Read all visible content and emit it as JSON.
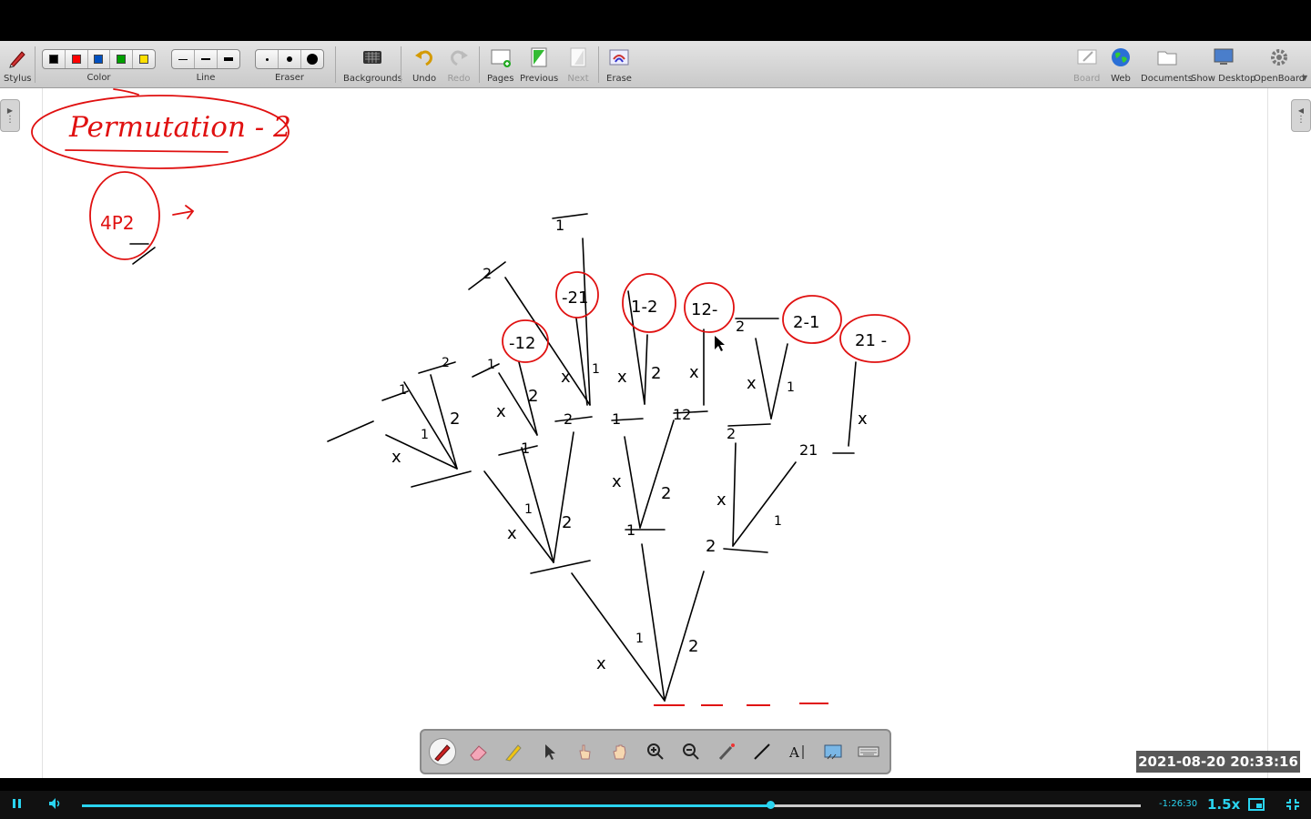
{
  "toolbar": {
    "stylus": "Stylus",
    "color": "Color",
    "line": "Line",
    "eraser": "Eraser",
    "backgrounds": "Backgrounds",
    "undo": "Undo",
    "redo": "Redo",
    "pages": "Pages",
    "previous": "Previous",
    "next": "Next",
    "erase": "Erase",
    "board": "Board",
    "web": "Web",
    "documents": "Documents",
    "show_desktop": "Show Desktop",
    "openboard": "OpenBoard",
    "colors": [
      "#000000",
      "#ff0000",
      "#0050c0",
      "#00a000",
      "#ffe000"
    ]
  },
  "board": {
    "title_text": "Permutation - 2",
    "notation": "4P2",
    "ink_red": "#e01010",
    "ink_black": "#000000"
  },
  "floating_toolbar": {
    "tools": [
      "pen-icon",
      "eraser-icon",
      "highlighter-icon",
      "select-pointer-icon",
      "interact-hand-icon",
      "pan-hand-icon",
      "zoom-in-icon",
      "zoom-out-icon",
      "laser-pointer-icon",
      "line-icon",
      "text-icon",
      "capture-icon",
      "keyboard-icon"
    ]
  },
  "overlay": {
    "timestamp": "2021-08-20  20:33:16"
  },
  "player": {
    "time_remaining": "-1:26:30",
    "speed": "1.5x",
    "progress": 0.65
  }
}
